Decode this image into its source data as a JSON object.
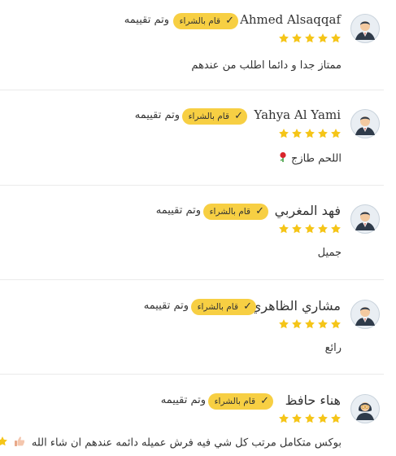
{
  "colors": {
    "badge": "#f7cf43",
    "star": "#f5c518",
    "separator": "#ebebeb",
    "text": "#333333"
  },
  "reviews": [
    {
      "name": "Ahmed Alsaqqaf",
      "badge": "قام بالشراء",
      "rated": "وتم تقييمه",
      "rating": 5,
      "comment": "ممتاز جدا و دائما اطلب من عندهم",
      "avatar": "avatar-male-icon"
    },
    {
      "name": "Yahya Al Yami",
      "badge": "قام بالشراء",
      "rated": "وتم تقييمه",
      "rating": 5,
      "comment": "اللحم طازج",
      "comment_emoji": "rose-icon",
      "avatar": "avatar-male-icon"
    },
    {
      "name": "فهد المغربي",
      "badge": "قام بالشراء",
      "rated": "وتم تقييمه",
      "rating": 5,
      "comment": "جميل",
      "avatar": "avatar-male-icon"
    },
    {
      "name": "مشاري الظاهري",
      "badge": "قام بالشراء",
      "rated": "وتم تقييمه",
      "rating": 5,
      "comment": "رائع",
      "avatar": "avatar-male-icon"
    },
    {
      "name": "هناء حافظ",
      "badge": "قام بالشراء",
      "rated": "وتم تقييمه",
      "rating": 5,
      "comment": "بوكس متكامل مرتب كل شي فيه فرش عميله دائمه عندهم ان شاء الله",
      "comment_emoji": [
        "thumbs-up-icon",
        "star-icon"
      ],
      "avatar": "avatar-female-icon"
    }
  ]
}
